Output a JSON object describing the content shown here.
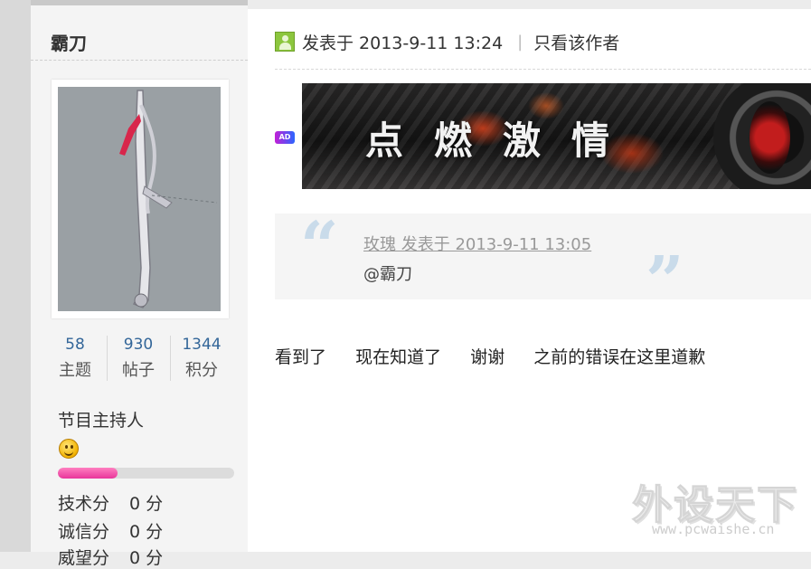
{
  "author": {
    "name": "霸刀",
    "stats": [
      {
        "value": "58",
        "label": "主题"
      },
      {
        "value": "930",
        "label": "帖子"
      },
      {
        "value": "1344",
        "label": "积分"
      }
    ],
    "group": "节目主持人",
    "level_progress": 0.34,
    "scores": [
      {
        "label": "技术分",
        "value": "0 分"
      },
      {
        "label": "诚信分",
        "value": "0 分"
      },
      {
        "label": "威望分",
        "value": "0 分"
      }
    ]
  },
  "post": {
    "posted_at": "发表于 2013-9-11 13:24",
    "only_author": "只看该作者",
    "ad_badge": "AD",
    "ad_text": "点燃激情",
    "quote": {
      "meta": "玫瑰 发表于 2013-9-11 13:05",
      "body": "@霸刀",
      "open_mark": "“",
      "close_mark": "”"
    },
    "content_segments": [
      "看到了",
      "现在知道了",
      "谢谢",
      "之前的错误在这里道歉"
    ]
  },
  "watermark": {
    "title": "外设天下",
    "url": "www.pcwaishe.cn"
  },
  "colors": {
    "link_blue": "#336699",
    "level_pink": "#e8359a",
    "user_icon_green": "#8cc63e",
    "quote_mark": "#c9dbea"
  },
  "icons": [
    "user-icon",
    "smiley-icon",
    "ad-badge-icon",
    "sword-avatar"
  ]
}
